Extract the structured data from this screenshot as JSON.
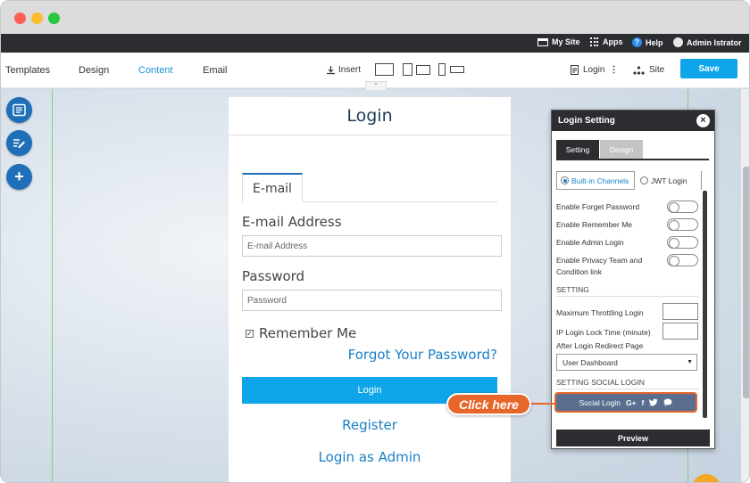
{
  "topbar": {
    "my_site": "My Site",
    "apps": "Apps",
    "help": "Help",
    "user": "Admin Istrator"
  },
  "toolbar": {
    "tabs": [
      "Templates",
      "Design",
      "Content",
      "Email"
    ],
    "active_tab": "Content",
    "insert": "Insert",
    "page_select": "Login",
    "site_select": "Site",
    "save": "Save"
  },
  "login_form": {
    "title": "Login",
    "tab": "E-mail",
    "email_label": "E-mail Address",
    "email_placeholder": "E-mail Address",
    "password_label": "Password",
    "password_placeholder": "Password",
    "remember": "Remember Me",
    "forgot": "Forgot Your Password?",
    "login_button": "Login",
    "register": "Register",
    "login_admin": "Login as Admin"
  },
  "panel": {
    "title": "Login Setting",
    "tabs": [
      "Setting",
      "Design"
    ],
    "channels": [
      "Built-in Channels",
      "JWT Login"
    ],
    "toggles": [
      "Enable Forget Password",
      "Enable Remember Me",
      "Enable Admin Login",
      "Enable Privacy Team and Condition link"
    ],
    "section_setting": "SETTING",
    "max_throttling": "Maximum Throttling Login",
    "ip_lock": "IP Login Lock Time (minute)",
    "redirect_label": "After Login Redirect Page",
    "redirect_value": "User Dashboard",
    "section_social": "SETTING SOCIAL LOGIN",
    "social_button": "Social Login",
    "preview": "Preview"
  },
  "callout": "Click here",
  "colors": {
    "accent": "#0ea5e9",
    "dark": "#2b2d31",
    "callout": "#e7662a",
    "link": "#1a7fc7"
  }
}
